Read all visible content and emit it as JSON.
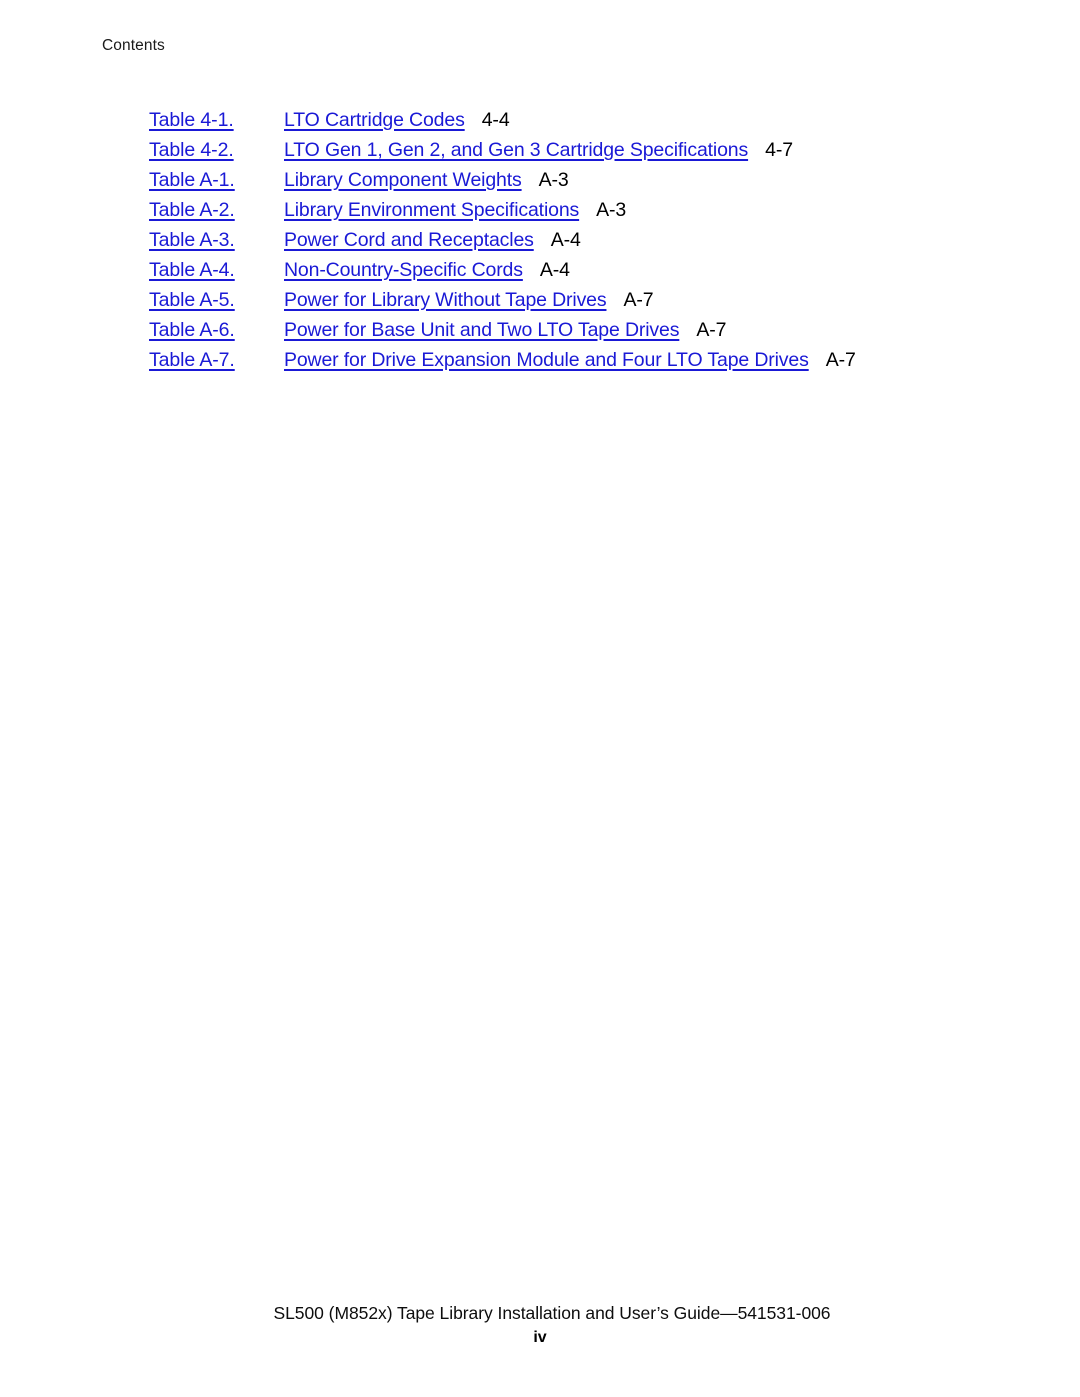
{
  "document": {
    "running_header": "Contents",
    "page_folio": "iv",
    "footer_line": "SL500 (M852x) Tape Library Installation and User’s Guide—541531-006"
  },
  "colors": {
    "link_blue": "#1a19d6",
    "body_black": "#000000",
    "page_background": "#ffffff"
  },
  "list_of_tables": {
    "entries": [
      {
        "label": "Table 4-1.",
        "title": "LTO Cartridge Codes",
        "page": "4-4"
      },
      {
        "label": "Table 4-2.",
        "title": "LTO Gen 1, Gen 2, and Gen 3 Cartridge Specifications",
        "page": "4-7"
      },
      {
        "label": "Table A-1.",
        "title": "Library Component Weights",
        "page": "A-3"
      },
      {
        "label": "Table A-2.",
        "title": "Library Environment Specifications",
        "page": "A-3"
      },
      {
        "label": "Table A-3.",
        "title": "Power Cord and Receptacles",
        "page": "A-4"
      },
      {
        "label": "Table A-4.",
        "title": "Non-Country-Specific Cords",
        "page": "A-4"
      },
      {
        "label": "Table A-5.",
        "title": "Power for Library Without Tape Drives",
        "page": "A-7"
      },
      {
        "label": "Table A-6.",
        "title": "Power for Base Unit and Two LTO Tape Drives",
        "page": "A-7"
      },
      {
        "label": "Table A-7.",
        "title": "Power for Drive Expansion Module and Four LTO Tape Drives",
        "page": "A-7"
      }
    ]
  }
}
